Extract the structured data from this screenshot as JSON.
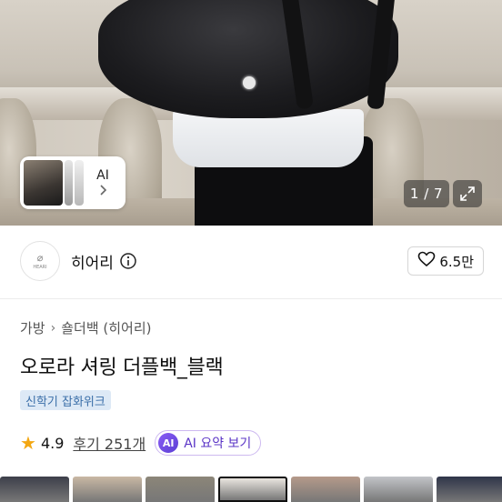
{
  "gallery": {
    "counter": "1 / 7",
    "ai_card": {
      "label": "AI"
    }
  },
  "shop": {
    "name": "히어리",
    "logo_text": "HEARI",
    "likes": "6.5만"
  },
  "product": {
    "breadcrumb": [
      "가방",
      "숄더백 (히어리)"
    ],
    "title": "오로라 셔링 더플백_블랙",
    "tag": "신학기 잡화위크",
    "rating": "4.9",
    "reviews": "후기 251개",
    "ai_summary": {
      "badge": "AI",
      "label": "AI 요약 보기"
    }
  },
  "colors": {
    "tag_bg": "#dde9f6",
    "tag_text": "#3a6ea8",
    "star": "#f3a712",
    "ai_purple": "#5a34c6"
  },
  "thumbnail_strip": {
    "selected_index": 3,
    "thumbs": [
      {
        "color": "#3d3f4a"
      },
      {
        "color": "#c9b8a4"
      },
      {
        "color": "#8c8679"
      },
      {
        "color": "#e9e5df"
      },
      {
        "color": "#b59a8a"
      },
      {
        "color": "#c2c4c8"
      },
      {
        "color": "#2f3549"
      },
      {
        "color": "#9b7f6a"
      }
    ]
  }
}
